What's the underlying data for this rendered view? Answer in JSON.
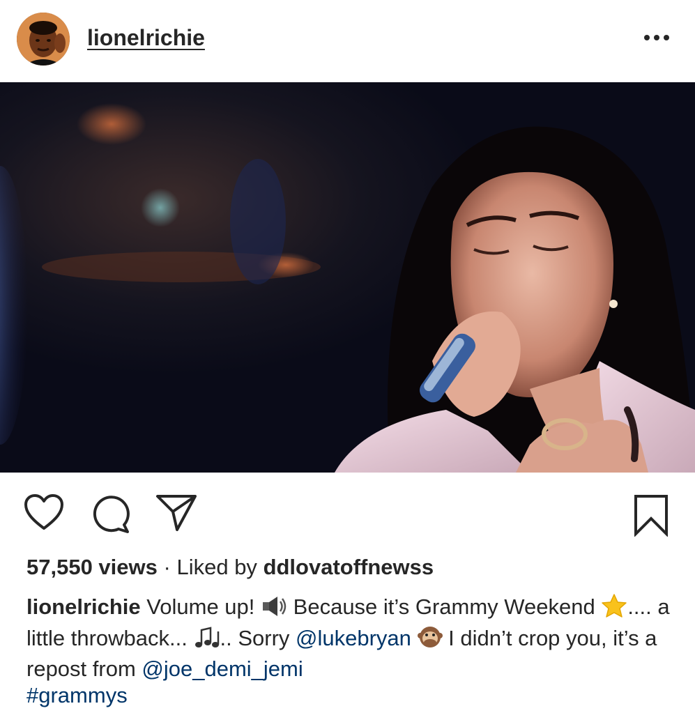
{
  "post": {
    "author": "lionelrichie",
    "avatar_icon": "profile-photo",
    "more_icon": "ellipsis-horizontal-icon"
  },
  "actions": {
    "like_icon": "heart-icon",
    "comment_icon": "comment-bubble-icon",
    "share_icon": "paper-plane-icon",
    "save_icon": "bookmark-icon"
  },
  "stats": {
    "views": "57,550 views",
    "separator": "·",
    "liked_by_prefix": "Liked by",
    "liked_by_user": "ddlovatoffnewss"
  },
  "caption": {
    "author": "lionelrichie",
    "part1": "Volume up!",
    "emoji_speaker": "speaker-loud-icon",
    "part2": "Because it’s Grammy Weekend",
    "emoji_star": "star-icon",
    "part3": ".... a little throwback...",
    "emoji_notes": "musical-notes-icon",
    "part4": ".. Sorry",
    "mention1": "@lukebryan",
    "emoji_monkey": "speak-no-evil-monkey-icon",
    "part5": "I didn’t crop you, it’s a repost from",
    "mention2": "@joe_demi_jemi",
    "hashtag": "#grammys"
  },
  "colors": {
    "text": "#262626",
    "link": "#003569",
    "background": "#ffffff"
  }
}
